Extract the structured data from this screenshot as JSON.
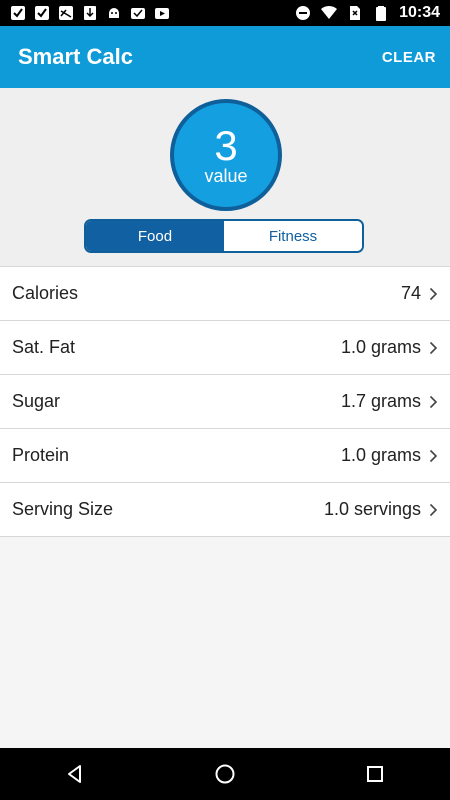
{
  "status_bar": {
    "time": "10:34",
    "icons": [
      "checkbox-icon",
      "checkbox-icon",
      "cast-icon",
      "download-icon",
      "android-icon",
      "check-cloud-icon",
      "play-store-icon",
      "dnd-icon",
      "wifi-icon",
      "no-sim-icon",
      "battery-icon"
    ]
  },
  "app_bar": {
    "title": "Smart Calc",
    "clear_label": "CLEAR",
    "color": "#0f9ad8"
  },
  "result": {
    "value": "3",
    "label": "value"
  },
  "toggle": {
    "options": [
      "Food",
      "Fitness"
    ],
    "selected": "Food"
  },
  "rows": [
    {
      "label": "Calories",
      "value": "74"
    },
    {
      "label": "Sat. Fat",
      "value": "1.0 grams"
    },
    {
      "label": "Sugar",
      "value": "1.7 grams"
    },
    {
      "label": "Protein",
      "value": "1.0 grams"
    },
    {
      "label": "Serving Size",
      "value": "1.0 servings"
    }
  ],
  "nav": {
    "back": "back-icon",
    "home": "home-icon",
    "recents": "recents-icon"
  }
}
